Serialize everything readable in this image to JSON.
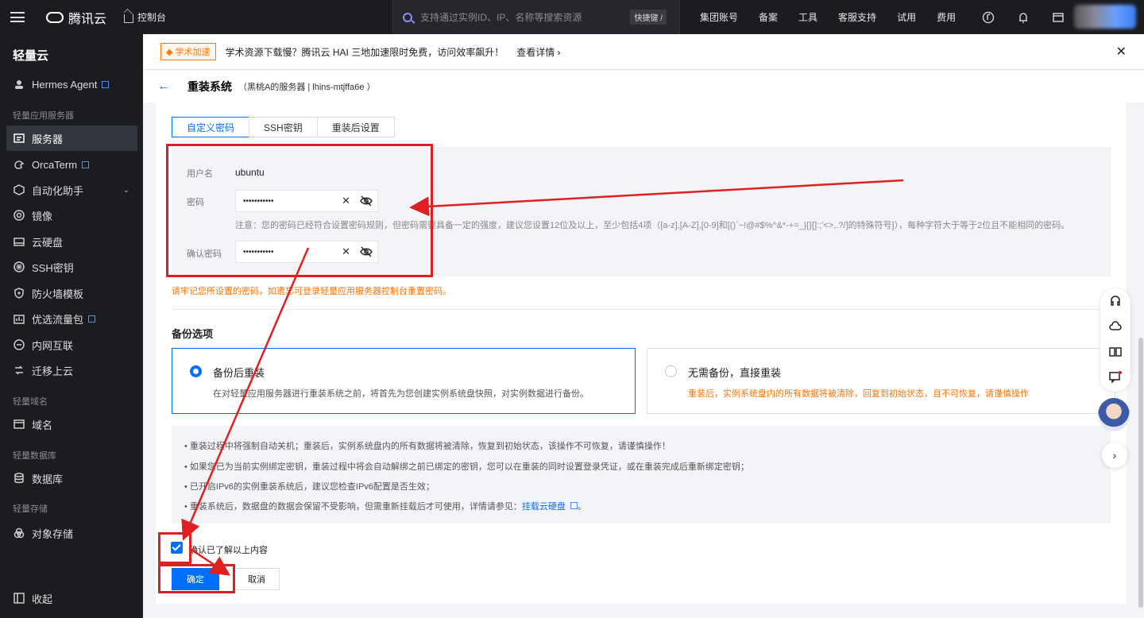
{
  "topbar": {
    "brand": "腾讯云",
    "console": "控制台",
    "search_placeholder": "支持通过实例ID、IP、名称等搜索资源",
    "shortcut": "快捷键 /",
    "nav": [
      "集团账号",
      "备案",
      "工具",
      "客服支持",
      "试用",
      "费用"
    ]
  },
  "sidebar": {
    "title": "轻量云",
    "items": {
      "hermes": "Hermes Agent",
      "sec_lh": "轻量应用服务器",
      "server": "服务器",
      "orca": "OrcaTerm",
      "auto": "自动化助手",
      "image": "镜像",
      "disk": "云硬盘",
      "ssh": "SSH密钥",
      "firewall": "防火墙模板",
      "traffic": "优选流量包",
      "intranet": "内网互联",
      "migrate": "迁移上云",
      "sec_domain": "轻量域名",
      "domain": "域名",
      "sec_db": "轻量数据库",
      "database": "数据库",
      "sec_storage": "轻量存储",
      "storage": "对象存储",
      "collapse": "收起"
    }
  },
  "banner": {
    "tag": "◆ 学术加速",
    "text": "学术资源下载慢？腾讯云 HAI 三地加速限时免费，访问效率飙升！",
    "link": "查看详情 ›"
  },
  "page": {
    "title": "重装系统",
    "subtitle": "（黑桃A的服务器 | lhins-mtjffa6e ）"
  },
  "tabs": [
    "自定义密码",
    "SSH密钥",
    "重装后设置"
  ],
  "form": {
    "username_label": "用户名",
    "username": "ubuntu",
    "password_label": "密码",
    "password": "•••••••••••",
    "confirm_label": "确认密码",
    "confirm": "•••••••••••",
    "note": "注意：您的密码已经符合设置密码规则，但密码需要具备一定的强度，建议您设置12位及以上，至少包括4项（[a-z],[A-Z],[0-9]和[()`~!@#$%^&*-+=_|{}[]:;'<>,.?/]的特殊符号]），每种字符大于等于2位且不能相同的密码。",
    "warn": "请牢记您所设置的密码，如遗忘可登录轻量应用服务器控制台重置密码。"
  },
  "backup": {
    "section": "备份选项",
    "opt1_title": "备份后重装",
    "opt1_desc": "在对轻量应用服务器进行重装系统之前，将首先为您创建实例系统盘快照，对实例数据进行备份。",
    "opt2_title": "无需备份，直接重装",
    "opt2_desc": "重装后，实例系统盘内的所有数据将被清除，回复到初始状态，且不可恢复，请谨慎操作"
  },
  "info": {
    "l1": "• 重装过程中将强制自动关机；重装后，实例系统盘内的所有数据将被清除，恢复到初始状态，该操作不可恢复，请谨慎操作！",
    "l2": "• 如果您已为当前实例绑定密钥，重装过程中将会自动解绑之前已绑定的密钥，您可以在重装的同时设置登录凭证，或在重装完成后重新绑定密钥；",
    "l3": "• 已开启IPv6的实例重装系统后，建议您检查IPv6配置是否生效；",
    "l4": "• 重装系统后，数据盘的数据会保留不受影响，但需重新挂载后才可使用，详情请参见：",
    "l4_link": "挂载云硬盘",
    "l4_end": "。"
  },
  "confirm": {
    "label": "确认已了解以上内容",
    "ok": "确定",
    "cancel": "取消"
  },
  "colors": {
    "accent": "#006eff",
    "annotation": "#e02020",
    "warning": "#ff7200"
  }
}
